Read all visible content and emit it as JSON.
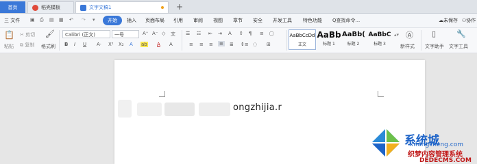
{
  "tabs": [
    {
      "label": "首页"
    },
    {
      "label": "稻壳模板"
    },
    {
      "label": "文字文稿1"
    }
  ],
  "new_tab": "+",
  "close_glyph": "×",
  "menu": {
    "file": "三 文件",
    "items": [
      "开始",
      "插入",
      "页面布局",
      "引用",
      "审阅",
      "视图",
      "章节",
      "安全",
      "开发工具",
      "特色功能"
    ],
    "search": "Q查找命令...",
    "unsaved": "未保存",
    "collab": "协作"
  },
  "ribbon": {
    "paste": "粘贴",
    "cut": "剪切",
    "copy": "复制",
    "format_painter": "格式刷",
    "font_name": "Calibri (正文)",
    "font_size": "一号",
    "bold": "B",
    "italic": "I",
    "underline": "U",
    "styles": [
      {
        "preview": "AaBbCcDd",
        "label": "正文"
      },
      {
        "preview": "AaBb",
        "label": "标题 1"
      },
      {
        "preview": "AaBb(",
        "label": "标题 2"
      },
      {
        "preview": "AaBbC",
        "label": "标题 3"
      }
    ],
    "new_style": "新样式",
    "doc_assistant": "文字助手",
    "text_tools": "文字工具"
  },
  "document": {
    "text": "ongzhijia.r"
  },
  "watermark": {
    "site1": "系统城",
    "url1": "xitongcheng.com",
    "site2": "织梦内容管理系统",
    "url2": "DEDECMS.COM"
  },
  "colors": {
    "accent": "#3a78d8",
    "watermark_blue": "#1e64c8",
    "watermark_red": "#c01818"
  }
}
